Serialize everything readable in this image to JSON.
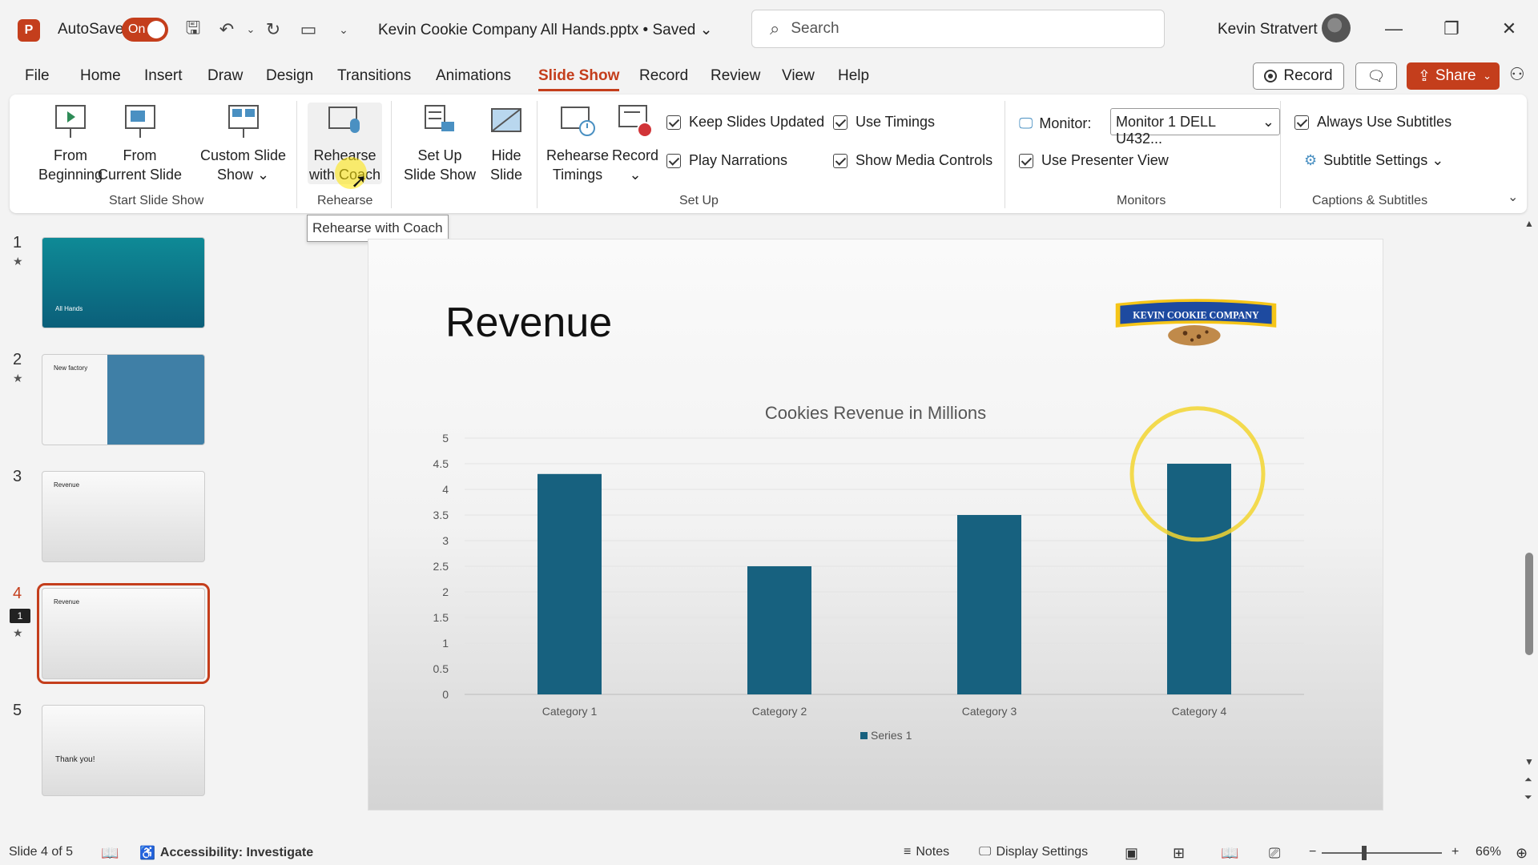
{
  "app": {
    "autosave_label": "AutoSave",
    "autosave_state": "On",
    "doc_title": "Kevin Cookie Company All Hands.pptx • Saved ⌄",
    "search_placeholder": "Search",
    "user_name": "Kevin Stratvert",
    "accent_color": "#c43e1c"
  },
  "menu": {
    "tabs": [
      "File",
      "Home",
      "Insert",
      "Draw",
      "Design",
      "Transitions",
      "Animations",
      "Slide Show",
      "Record",
      "Review",
      "View",
      "Help"
    ],
    "active_tab": "Slide Show",
    "record_button": "Record",
    "share_button": "Share"
  },
  "ribbon": {
    "start": {
      "from_beginning": [
        "From",
        "Beginning"
      ],
      "from_current": [
        "From",
        "Current Slide"
      ],
      "custom": [
        "Custom Slide",
        "Show ⌄"
      ],
      "group_label": "Start Slide Show"
    },
    "rehearse": {
      "coach": [
        "Rehearse",
        "with Coach"
      ],
      "group_label": "Rehearse"
    },
    "setup": {
      "set_up": [
        "Set Up",
        "Slide Show"
      ],
      "hide": [
        "Hide",
        "Slide"
      ],
      "timings": [
        "Rehearse",
        "Timings"
      ],
      "record": [
        "Record",
        "⌄"
      ],
      "keep_updated": "Keep Slides Updated",
      "play_narrations": "Play Narrations",
      "use_timings": "Use Timings",
      "show_media": "Show Media Controls",
      "group_label": "Set Up"
    },
    "monitors": {
      "monitor_label": "Monitor:",
      "monitor_value": "Monitor 1 DELL U432...",
      "presenter_view": "Use Presenter View",
      "group_label": "Monitors"
    },
    "captions": {
      "always_subtitles": "Always Use Subtitles",
      "subtitle_settings": "Subtitle Settings ⌄",
      "group_label": "Captions & Subtitles"
    }
  },
  "tooltip": "Rehearse with Coach",
  "thumbnails": [
    {
      "num": "1",
      "text": "All Hands"
    },
    {
      "num": "2",
      "text": "New factory"
    },
    {
      "num": "3",
      "text": "Revenue"
    },
    {
      "num": "4",
      "text": "Revenue",
      "comment_count": "1"
    },
    {
      "num": "5",
      "text": "Thank you!"
    }
  ],
  "slide": {
    "title": "Revenue",
    "logo_text": "KEVIN COOKIE COMPANY"
  },
  "chart_data": {
    "type": "bar",
    "title": "Cookies Revenue in Millions",
    "categories": [
      "Category 1",
      "Category 2",
      "Category 3",
      "Category 4"
    ],
    "series": [
      {
        "name": "Series 1",
        "values": [
          4.3,
          2.5,
          3.5,
          4.5
        ],
        "color": "#17617f"
      }
    ],
    "ylim": [
      0,
      5
    ],
    "yticks": [
      "0",
      "0.5",
      "1",
      "1.5",
      "2",
      "2.5",
      "3",
      "3.5",
      "4",
      "4.5",
      "5"
    ],
    "grid": true,
    "legend": "bottom",
    "highlight_category": "Category 4",
    "highlight_color": "#f2d530"
  },
  "status": {
    "slide_info": "Slide 4 of 5",
    "accessibility": "Accessibility: Investigate",
    "notes": "Notes",
    "display_settings": "Display Settings",
    "zoom": "66%"
  }
}
